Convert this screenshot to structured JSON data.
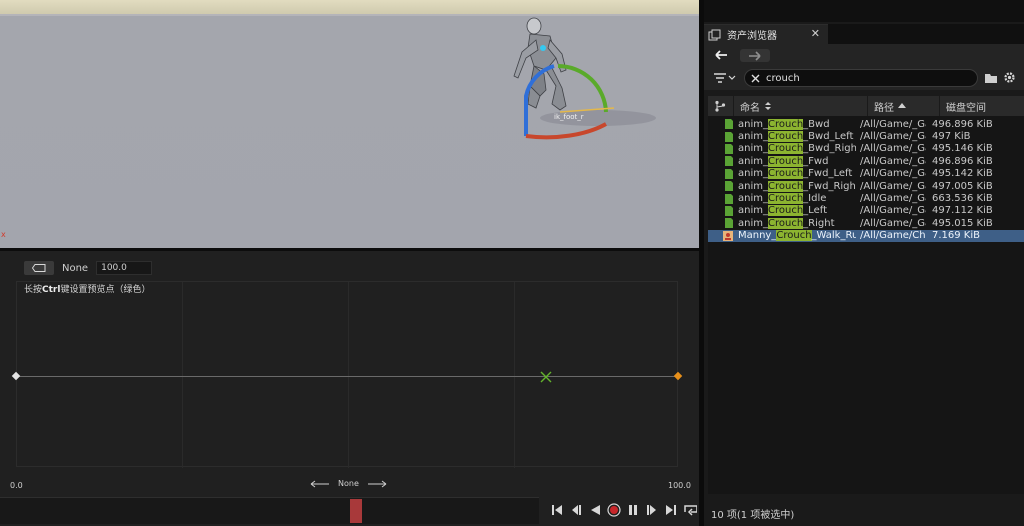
{
  "viewport": {
    "bone_label": "ik_foot_r",
    "axis_marker": "x"
  },
  "blend_space": {
    "parameter_name": "None",
    "parameter_value": "100.0",
    "hint_prefix": "长按",
    "hint_key": "Ctrl",
    "hint_suffix": "键设置预览点（绿色）",
    "axis_min": "0.0",
    "axis_max": "100.0",
    "axis_name": "None",
    "preview_fraction": 0.8
  },
  "timeline": {
    "playhead_fraction": 0.66
  },
  "content_browser": {
    "tab_title": "资产浏览器",
    "tab_close": "✕",
    "search_query": "crouch",
    "columns": {
      "name": "命名",
      "path": "路径",
      "size": "磁盘空间"
    },
    "assets": [
      {
        "pre": "anim_",
        "match": "Crouch",
        "post": "_Bwd",
        "path": "/All/Game/_Ga",
        "size": "496.896 KiB",
        "type": "animation",
        "selected": false
      },
      {
        "pre": "anim_",
        "match": "Crouch",
        "post": "_Bwd_Left",
        "path": "/All/Game/_Ga",
        "size": "497 KiB",
        "type": "animation",
        "selected": false
      },
      {
        "pre": "anim_",
        "match": "Crouch",
        "post": "_Bwd_Right",
        "path": "/All/Game/_Ga",
        "size": "495.146 KiB",
        "type": "animation",
        "selected": false
      },
      {
        "pre": "anim_",
        "match": "Crouch",
        "post": "_Fwd",
        "path": "/All/Game/_Ga",
        "size": "496.896 KiB",
        "type": "animation",
        "selected": false
      },
      {
        "pre": "anim_",
        "match": "Crouch",
        "post": "_Fwd_Left",
        "path": "/All/Game/_Ga",
        "size": "495.142 KiB",
        "type": "animation",
        "selected": false
      },
      {
        "pre": "anim_",
        "match": "Crouch",
        "post": "_Fwd_Right",
        "path": "/All/Game/_Ga",
        "size": "497.005 KiB",
        "type": "animation",
        "selected": false
      },
      {
        "pre": "anim_",
        "match": "Crouch",
        "post": "_Idle",
        "path": "/All/Game/_Ga",
        "size": "663.536 KiB",
        "type": "animation",
        "selected": false
      },
      {
        "pre": "anim_",
        "match": "Crouch",
        "post": "_Left",
        "path": "/All/Game/_Ga",
        "size": "497.112 KiB",
        "type": "animation",
        "selected": false
      },
      {
        "pre": "anim_",
        "match": "Crouch",
        "post": "_Right",
        "path": "/All/Game/_Ga",
        "size": "495.015 KiB",
        "type": "animation",
        "selected": false
      },
      {
        "pre": "Manny_",
        "match": "Crouch",
        "post": "_Walk_Run",
        "path": "/All/Game/Ch",
        "size": "7.169 KiB",
        "type": "blendspace",
        "selected": true
      }
    ],
    "status": "10 项(1 项被选中)",
    "colors": {
      "highlight": "#8cb430",
      "selection": "#3e5f87",
      "anim_icon": "#5aa335"
    }
  }
}
